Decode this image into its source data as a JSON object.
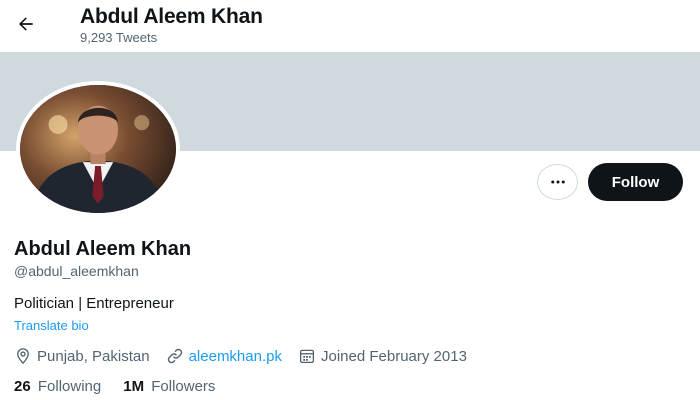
{
  "header": {
    "name": "Abdul Aleem Khan",
    "tweet_count": "9,293 Tweets"
  },
  "actions": {
    "follow_label": "Follow"
  },
  "profile": {
    "display_name": "Abdul Aleem Khan",
    "handle": "@abdul_aleemkhan",
    "bio": "Politician | Entrepreneur",
    "translate_label": "Translate bio",
    "location": "Punjab, Pakistan",
    "website": "aleemkhan.pk",
    "joined": "Joined February 2013"
  },
  "stats": {
    "following_count": "26",
    "following_label": "Following",
    "followers_count": "1M",
    "followers_label": "Followers"
  },
  "colors": {
    "accent": "#1d9bf0",
    "banner": "#cfd9de",
    "follow_button": "#0f1419",
    "secondary_text": "#536471"
  },
  "icons": [
    "back-arrow-icon",
    "more-icon",
    "location-icon",
    "link-icon",
    "calendar-icon"
  ]
}
